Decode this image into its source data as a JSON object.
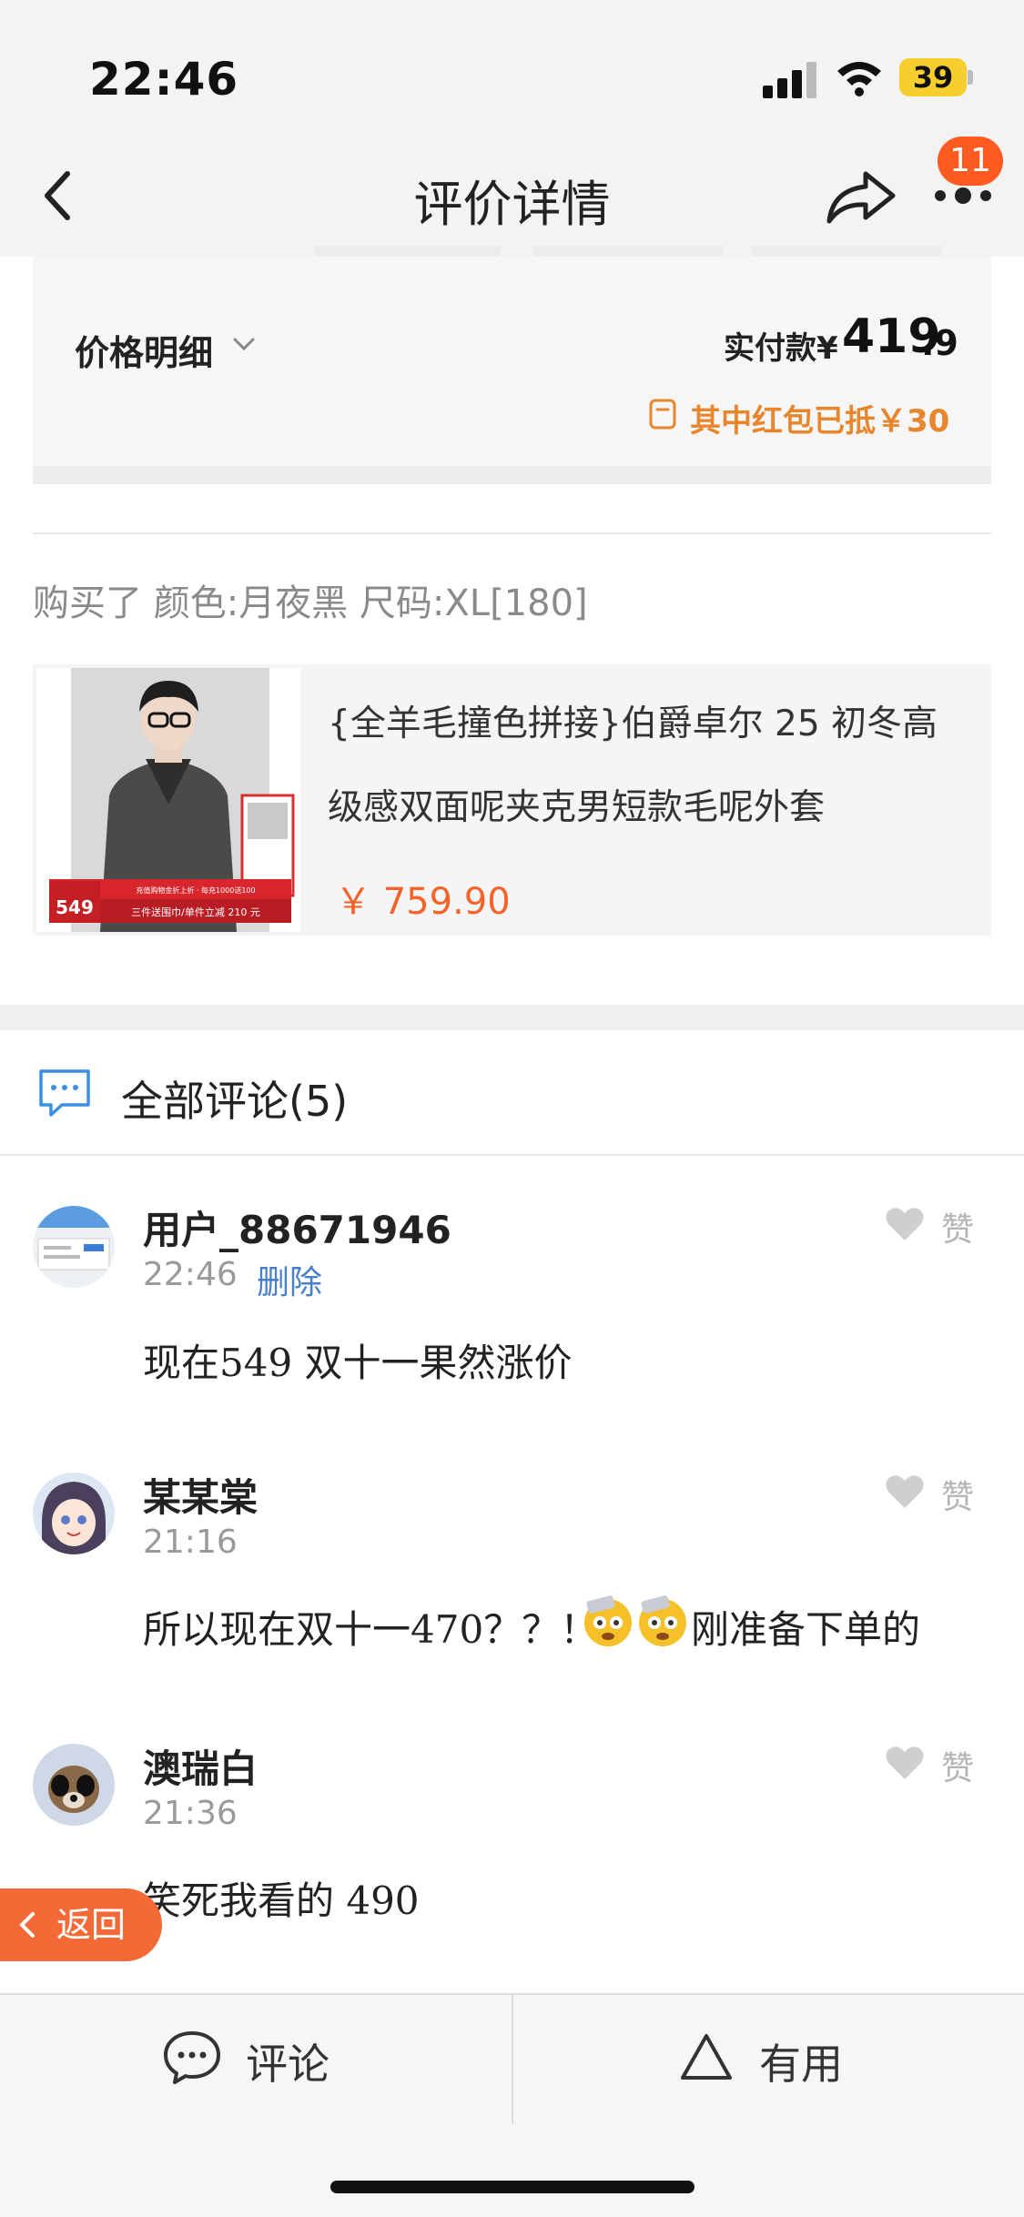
{
  "status_bar": {
    "time": "22:46",
    "battery": "39"
  },
  "nav": {
    "title": "评价详情",
    "badge_count": "11"
  },
  "price_detail": {
    "label": "价格明细",
    "paid_label": "实付款¥",
    "paid_int": "419",
    "paid_dec": ".9",
    "redpacket_text": "其中红包已抵￥30"
  },
  "purchase": {
    "spec": "购买了 颜色:月夜黑 尺码:XL[180]"
  },
  "product": {
    "title": "{全羊毛撞色拼接}伯爵卓尔 25 初冬高级感双面呢夹克男短款毛呢外套",
    "price": "￥ 759.90",
    "img_price": "549",
    "img_banner_top": "充值购物金折上折 · 每充1000送100",
    "img_banner_bottom": "三件送围巾/单件立减 210 元"
  },
  "comments_header": {
    "title": "全部评论(5)"
  },
  "comments": [
    {
      "name": "用户_88671946",
      "time": "22:46",
      "delete_label": "删除",
      "text": "现在549 双十一果然涨价",
      "like_label": "赞"
    },
    {
      "name": "某某棠",
      "time": "21:16",
      "text": "所以现在双十一470？？！",
      "emoji_after": "刚准备下单的",
      "like_label": "赞"
    },
    {
      "name": "澳瑞白",
      "time": "21:36",
      "text": "笑死我看的 490",
      "like_label": "赞"
    }
  ],
  "return_button": {
    "label": "返回"
  },
  "bottom_bar": {
    "comment_label": "评论",
    "useful_label": "有用"
  },
  "colors": {
    "accent_orange": "#f5632b",
    "link_blue": "#4a7fc9",
    "redpack_orange": "#e8862d"
  }
}
